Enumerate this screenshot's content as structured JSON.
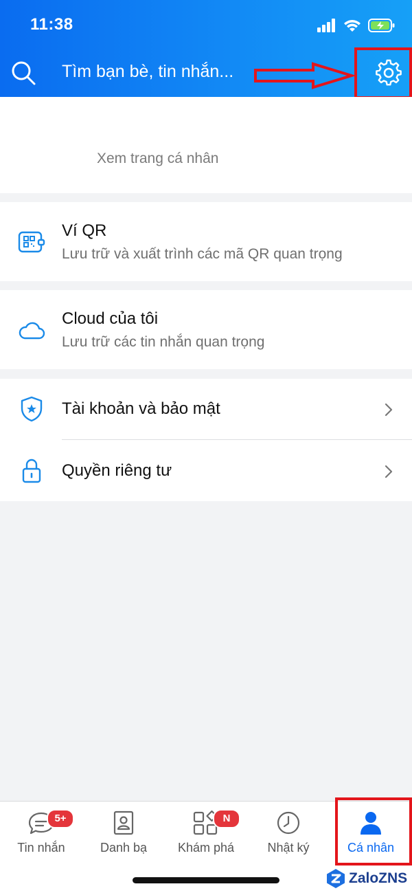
{
  "status_bar": {
    "time": "11:38"
  },
  "header": {
    "search_placeholder": "Tìm bạn bè, tin nhắn...",
    "accent_color": "#0a6cf0"
  },
  "profile": {
    "view_profile_label": "Xem trang cá nhân"
  },
  "features": [
    {
      "title": "Ví QR",
      "subtitle": "Lưu trữ và xuất trình các mã QR quan trọng",
      "icon": "qr-wallet-icon"
    },
    {
      "title": "Cloud của tôi",
      "subtitle": "Lưu trữ các tin nhắn quan trọng",
      "icon": "cloud-icon"
    }
  ],
  "settings": [
    {
      "label": "Tài khoản và bảo mật",
      "icon": "shield-icon"
    },
    {
      "label": "Quyền riêng tư",
      "icon": "lock-icon"
    }
  ],
  "bottom_nav": {
    "items": [
      {
        "label": "Tin nhắn",
        "badge": "5+",
        "icon": "chat-icon"
      },
      {
        "label": "Danh bạ",
        "icon": "contacts-icon"
      },
      {
        "label": "Khám phá",
        "badge": "N",
        "icon": "discover-icon"
      },
      {
        "label": "Nhật ký",
        "icon": "clock-icon"
      },
      {
        "label": "Cá nhân",
        "icon": "person-icon",
        "active": true
      }
    ]
  },
  "watermark": {
    "text": "ZaloZNS"
  },
  "annotation_color": "#e3151b"
}
